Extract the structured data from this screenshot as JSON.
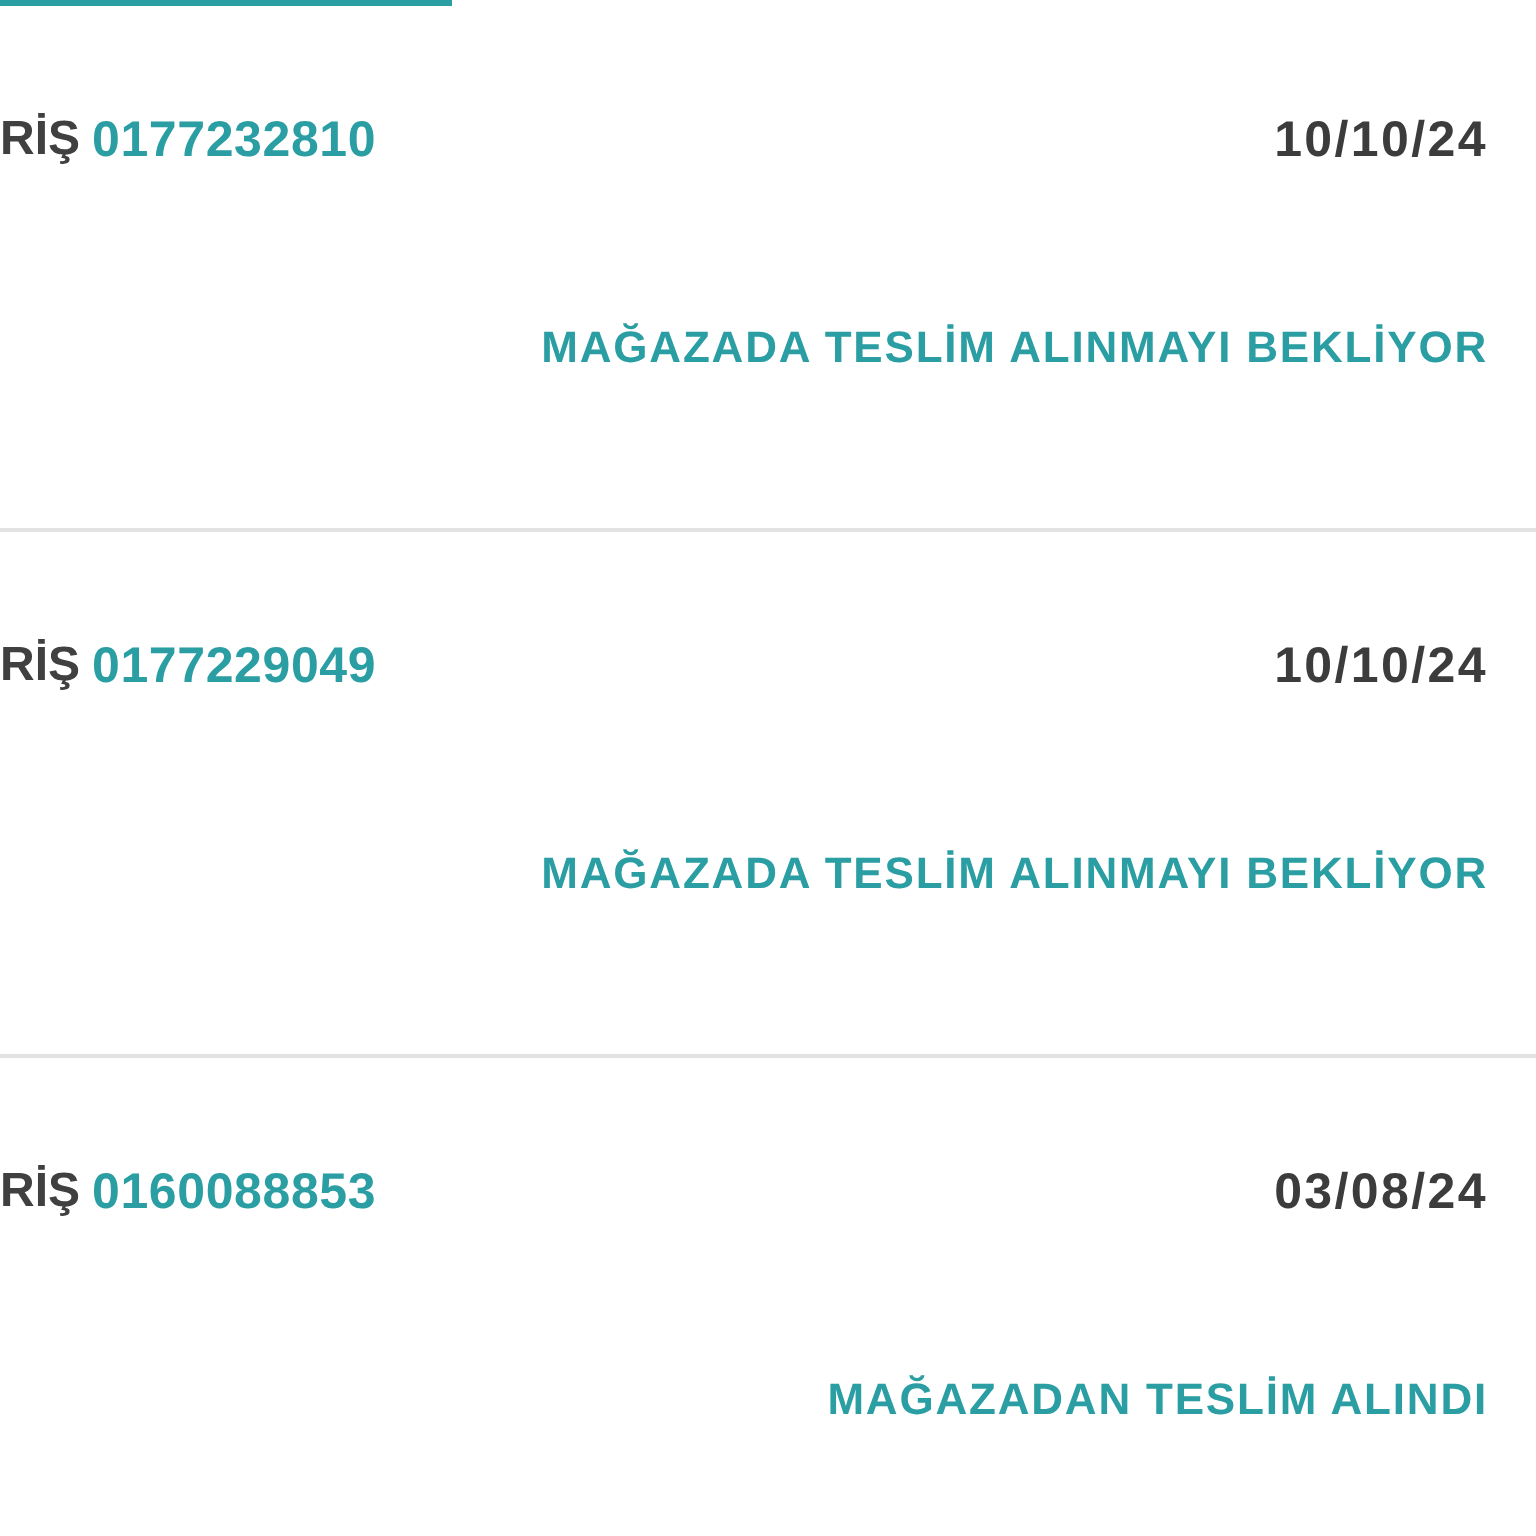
{
  "orders": [
    {
      "label": "RİŞ",
      "number": "0177232810",
      "date": "10/10/24",
      "status": "MAĞAZADA TESLİM ALINMAYI BEKLİYOR"
    },
    {
      "label": "RİŞ",
      "number": "0177229049",
      "date": "10/10/24",
      "status": "MAĞAZADA TESLİM ALINMAYI BEKLİYOR"
    },
    {
      "label": "RİŞ",
      "number": "0160088853",
      "date": "03/08/24",
      "status": "MAĞAZADAN TESLİM ALINDI"
    }
  ]
}
